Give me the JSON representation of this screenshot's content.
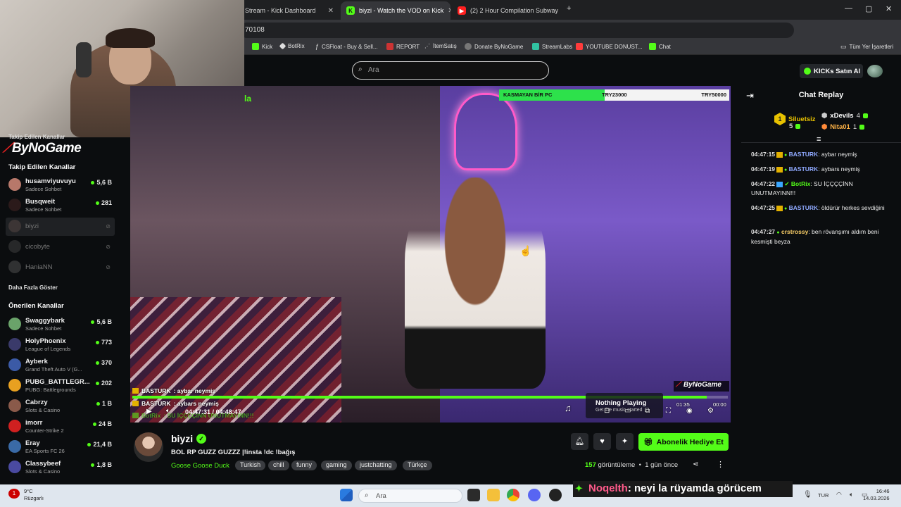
{
  "browser": {
    "tabs": [
      {
        "title": "Stream - Kick Dashboard",
        "active": false
      },
      {
        "title": "biyzi - Watch the VOD on Kick",
        "active": true
      },
      {
        "title": "(2) 2 Hour Compilation Subway",
        "active": false
      }
    ],
    "new_tab": "+",
    "url_fragment": "70108",
    "bookmarks": [
      "Kick",
      "BotRix",
      "CSFloat - Buy & Sell...",
      "REPORT",
      "İtemSatış",
      "Donate ByNoGame",
      "StreamLabs",
      "YOUTUBE DONUST...",
      "Chat"
    ],
    "all_bookmarks": "Tüm Yer İşaretleri"
  },
  "kick": {
    "search_placeholder": "Ara",
    "buy_kicks": "KICKs Satın Al",
    "brand_overlay": "ByNoGame"
  },
  "sidebar": {
    "overlay_heading": "Takip Edilen Kanallar",
    "followed_heading": "Takip Edilen Kanallar",
    "followed": [
      {
        "name": "husamviyuvuyu",
        "sub": "Sadece Sohbet",
        "count": "5,6 B",
        "color": "#b7786a"
      },
      {
        "name": "Busqweit",
        "sub": "Sadece Sohbet",
        "count": "281",
        "color": "#2b1a1a"
      },
      {
        "name": "biyzi",
        "offline": true,
        "color": "#5a4a46"
      },
      {
        "name": "cicobyte",
        "offline": true,
        "color": "#444"
      },
      {
        "name": "HaniaNN",
        "offline": true,
        "color": "#555"
      }
    ],
    "show_more": "Daha Fazla Göster",
    "recommended_heading": "Önerilen Kanallar",
    "recommended": [
      {
        "name": "Swaggybark",
        "sub": "Sadece Sohbet",
        "count": "5,6 B",
        "color": "#6aa36a"
      },
      {
        "name": "HolyPhoenix",
        "sub": "League of Legends",
        "count": "773",
        "color": "#3a3a6a"
      },
      {
        "name": "Ayberk",
        "sub": "Grand Theft Auto V (G...",
        "count": "370",
        "color": "#3b5aa6"
      },
      {
        "name": "PUBG_BATTLEGR...",
        "sub": "PUBG: Battlegrounds",
        "count": "202",
        "color": "#e8a020"
      },
      {
        "name": "Cabrzy",
        "sub": "Slots & Casino",
        "count": "1 B",
        "color": "#8a5a4a"
      },
      {
        "name": "imorr",
        "sub": "Counter-Strike 2",
        "count": "24 B",
        "color": "#d02020"
      },
      {
        "name": "Eray",
        "sub": "EA Sports FC 26",
        "count": "21,4 B",
        "color": "#3a6aa6"
      },
      {
        "name": "Classybeef",
        "sub": "Slots & Casino",
        "count": "1,8 B",
        "color": "#4a4aa0"
      }
    ]
  },
  "video": {
    "subgoal_label": "KASMAYAN BİR PC",
    "subgoal_mid": "TRY23000",
    "subgoal_end": "TRY50000",
    "subgoal_fraction": 0.46,
    "progress_fraction": 0.965,
    "chat_overlay": [
      {
        "user": "BASTURK",
        "text": ": aybar neymiş"
      },
      {
        "user": "BASTURK",
        "text": ": aybars neymiş"
      },
      {
        "user": "BotRix",
        "text": ": SU İÇÇÇÇİNN UNUTMAYINN!!!"
      }
    ],
    "time_current": "04:47:31",
    "time_sep": "/",
    "time_total": "04:48:47",
    "music_title": "Nothing Playing",
    "music_sub": "Get the music started",
    "mini_time_a": "01:35",
    "mini_time_b": "00:00",
    "brand_badge": "ByNoGame"
  },
  "chat": {
    "title": "Chat Replay",
    "top_gifters": [
      {
        "name": "Siluetsiz",
        "amount": "5",
        "color": "#e8c200"
      },
      {
        "name": "xDevils",
        "amount": "4",
        "color": "#ffffff"
      },
      {
        "name": "Nita01",
        "amount": "1",
        "color": "#ffb347"
      }
    ],
    "messages": [
      {
        "time": "04:47:15",
        "user": "BASTURK",
        "text": ": aybar neymiş"
      },
      {
        "time": "04:47:19",
        "user": "BASTURK",
        "text": ": aybars neymiş"
      },
      {
        "time": "04:47:22",
        "user": "BotRix",
        "text": ": SU İÇÇÇÇİNN UNUTMAYINN!!!"
      },
      {
        "time": "04:47:25",
        "user": "BASTURK",
        "text": ": öldürür herkes sevdiğini"
      },
      {
        "time": "04:47:27",
        "user": "crstrossy",
        "text": ": ben rövanşımı aldım beni kesmişti beyza"
      }
    ]
  },
  "stream_info": {
    "name": "biyzi",
    "title": "BOL RP GUZZ GUZZZ |!insta !dc !bağış",
    "category": "Goose Goose Duck",
    "tags": [
      "Turkish",
      "chill",
      "funny",
      "gaming",
      "justchatting",
      "Türkçe"
    ],
    "gift_button": "Abonelik Hediye Et",
    "views_count": "157",
    "views_label": "görüntüleme",
    "ago": "1 gün önce"
  },
  "caption": {
    "user": "Noqelth",
    "text": ": neyi la rüyamda görücem"
  },
  "taskbar": {
    "weather_temp": "9°C",
    "weather_desc": "Rüzgarlı",
    "weather_badge": "1",
    "search_placeholder": "Ara",
    "lang": "TUR",
    "time": "16:46",
    "date": "14.03.2026"
  },
  "colors": {
    "kick_green": "#53fc18",
    "bg": "#0b0d0f"
  }
}
